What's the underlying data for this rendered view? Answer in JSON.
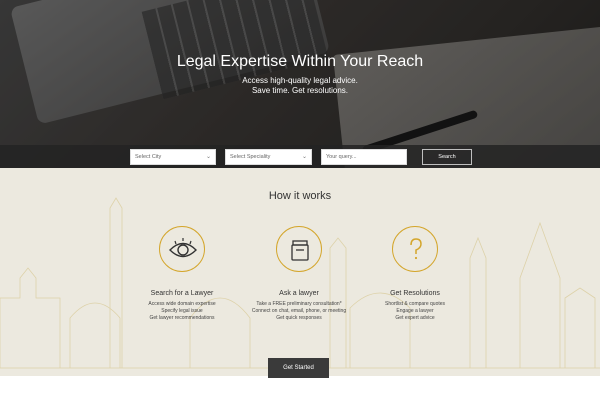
{
  "hero": {
    "title": "Legal Expertise Within Your Reach",
    "subtitle_line1": "Access high-quality legal advice.",
    "subtitle_line2": "Save time. Get resolutions."
  },
  "search": {
    "city_placeholder": "Select City",
    "specialty_placeholder": "Select Speciality",
    "query_placeholder": "Your query...",
    "button_label": "Search"
  },
  "how_it_works": {
    "title": "How it works",
    "steps": [
      {
        "icon": "eye-icon",
        "title": "Search for a Lawyer",
        "lines": [
          "Access wide domain expertise",
          "Specify legal issue",
          "Get lawyer recommendations"
        ]
      },
      {
        "icon": "jar-icon",
        "title": "Ask a lawyer",
        "lines": [
          "Take a FREE preliminary consultation*",
          "Connect on chat, email, phone, or meeting",
          "Get quick responses"
        ]
      },
      {
        "icon": "question-icon",
        "title": "Get Resolutions",
        "lines": [
          "Shortlist & compare quotes",
          "Engage a lawyer",
          "Get expert advice"
        ]
      }
    ],
    "cta_label": "Get Started"
  },
  "colors": {
    "accent": "#d4a62c",
    "band": "#ece9df",
    "cta_bg": "#3a3a3a"
  }
}
